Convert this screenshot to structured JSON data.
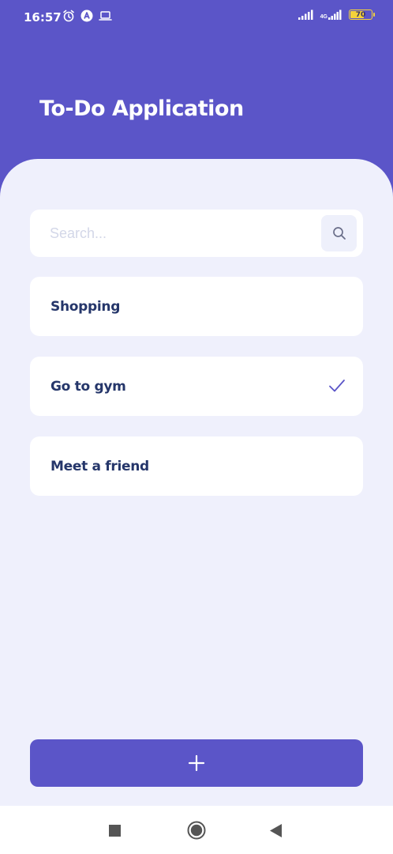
{
  "status_bar": {
    "time": "16:57",
    "left_icons": [
      "alarm-icon",
      "app-notification-icon",
      "laptop-icon"
    ],
    "network_label": "4G",
    "battery_level": "70"
  },
  "header": {
    "title": "To-Do Application"
  },
  "search": {
    "placeholder": "Search..."
  },
  "todos": [
    {
      "label": "Shopping",
      "completed": false
    },
    {
      "label": "Go to gym",
      "completed": true
    },
    {
      "label": "Meet a friend",
      "completed": false
    }
  ],
  "add_button": {
    "icon": "plus-icon"
  },
  "nav_bar": {
    "icons": [
      "recents-square-icon",
      "home-circle-icon",
      "back-triangle-icon"
    ]
  },
  "colors": {
    "primary": "#5b55c8",
    "background": "#eff0fc",
    "card": "#ffffff",
    "text": "#25366a"
  }
}
